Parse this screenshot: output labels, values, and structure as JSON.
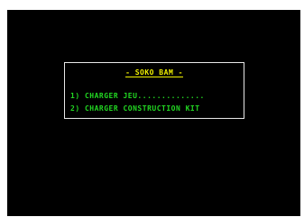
{
  "menu": {
    "title": "- SOKO BAM -",
    "items": [
      {
        "label": "1) CHARGER JEU.............."
      },
      {
        "label": "2) CHARGER CONSTRUCTION KIT"
      }
    ]
  },
  "colors": {
    "background": "#000000",
    "border": "#e8e8e8",
    "title": "#f2f200",
    "items": "#22d822"
  }
}
